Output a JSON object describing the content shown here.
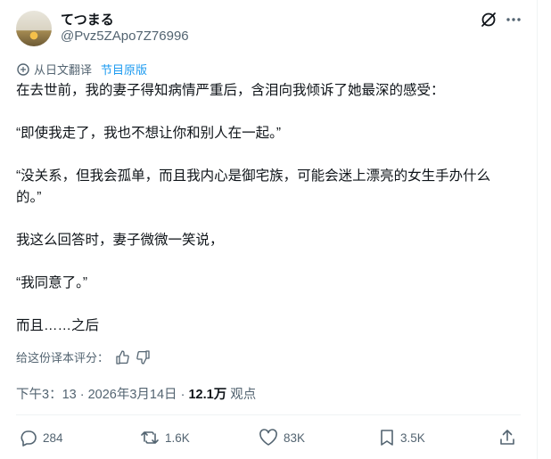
{
  "author": {
    "name": "てつまる",
    "handle": "@Pvz5ZApo7Z76996"
  },
  "translation": {
    "label": "从日文翻译",
    "original_link": "节目原版"
  },
  "paragraphs": [
    "在去世前，我的妻子得知病情严重后，含泪向我倾诉了她最深的感受：",
    "“即使我走了，我也不想让你和别人在一起。”",
    "“没关系，但我会孤单，而且我内心是御宅族，可能会迷上漂亮的女生手办什么的。”",
    "我这么回答时，妻子微微一笑说，",
    "“我同意了。”",
    "而且……之后"
  ],
  "rating": {
    "label": "给这份译本评分："
  },
  "meta": {
    "time": "下午3：13",
    "sep": "·",
    "date": "2026年3月14日",
    "views_count": "12.1万",
    "views_label": "观点"
  },
  "actions": {
    "replies": "284",
    "reposts": "1.6K",
    "likes": "83K",
    "bookmarks": "3.5K"
  },
  "colors": {
    "accent": "#1d9bf0",
    "secondary": "#536471",
    "text": "#0f1419"
  }
}
